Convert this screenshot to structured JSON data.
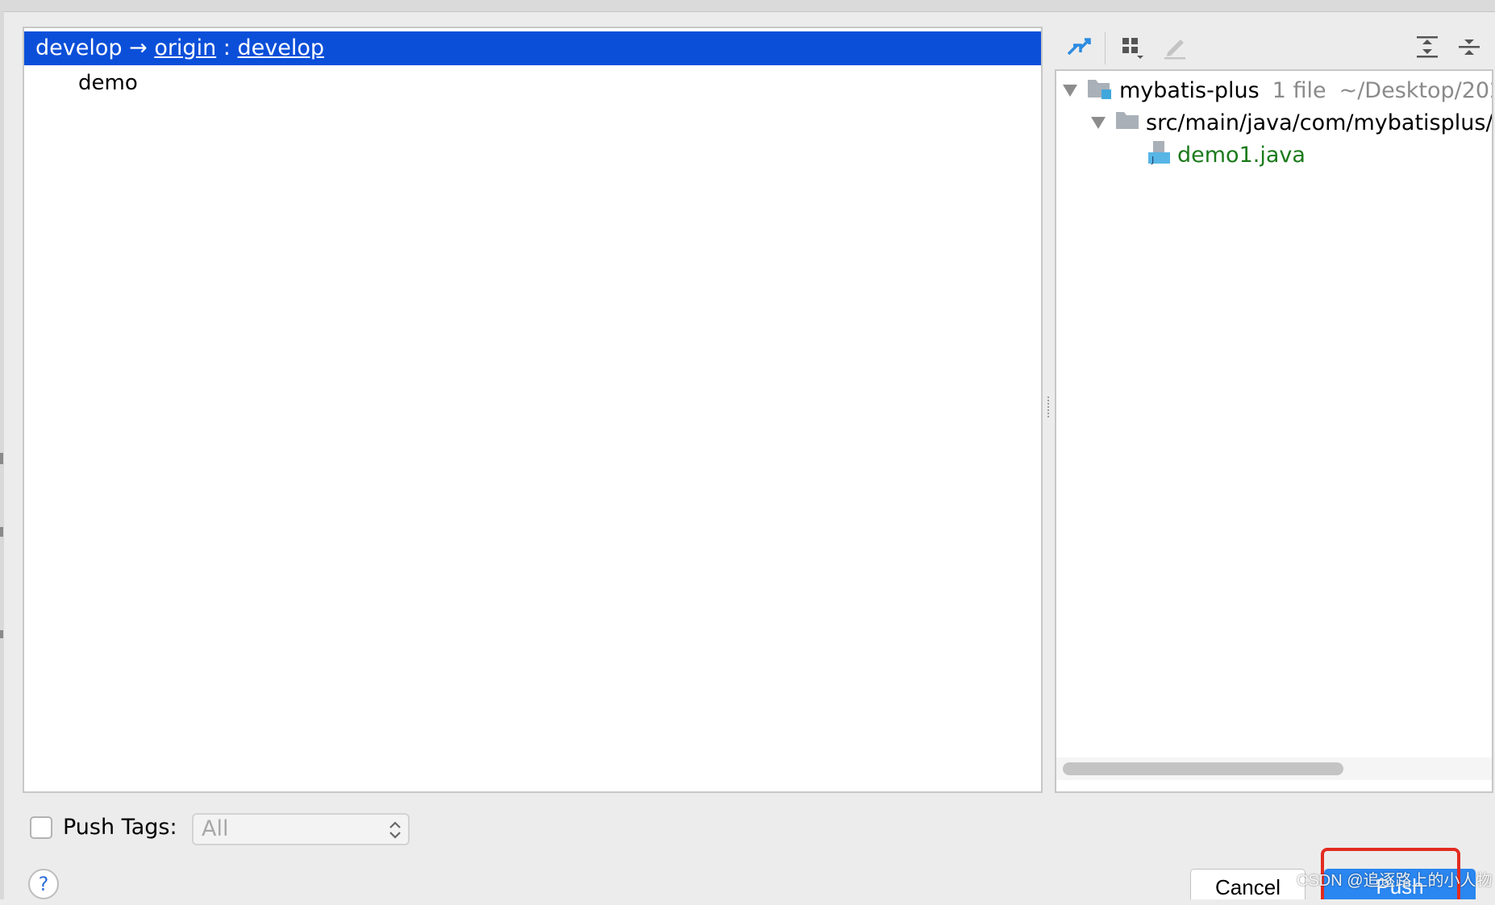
{
  "commits": {
    "branch": {
      "local": "develop",
      "arrow": "→",
      "remote": "origin",
      "sep": ":",
      "remote_branch": "develop"
    },
    "items": [
      "demo"
    ]
  },
  "toolbar": {
    "icons": [
      "pin-icon",
      "group-by-icon",
      "edit-icon",
      "expand-all-icon",
      "collapse-all-icon"
    ]
  },
  "changes": {
    "root": {
      "name": "mybatis-plus",
      "count": "1 file",
      "path": "~/Desktop/202"
    },
    "folder": "src/main/java/com/mybatisplus/",
    "file": "demo1.java"
  },
  "push_tags": {
    "label": "Push Tags:",
    "value": "All",
    "checked": false
  },
  "buttons": {
    "help": "?",
    "cancel": "Cancel",
    "push": "Push"
  },
  "watermark": "CSDN @追逐路上的小人物",
  "colors": {
    "selection": "#0b4fd9",
    "primary": "#2a86f0",
    "highlight_box": "#e32b20",
    "file_added": "#1b7a1b"
  }
}
